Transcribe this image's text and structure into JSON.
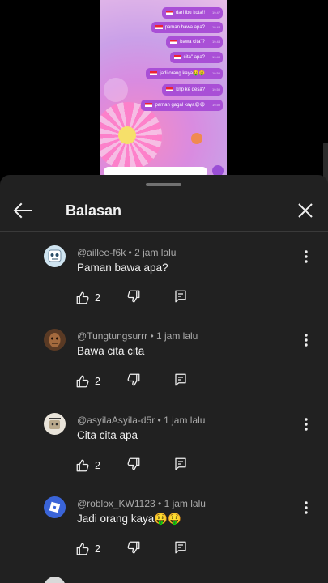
{
  "video": {
    "messages": [
      {
        "text": "dari ibu kota!!",
        "time": "19.47"
      },
      {
        "text": "paman bawa apa?",
        "time": "19.48"
      },
      {
        "text": "bawa cita\"?",
        "time": "19.48"
      },
      {
        "text": "cita\" apa?",
        "time": "19.49"
      },
      {
        "text": "jadi orang kaya🤑🤑",
        "time": "19.50"
      },
      {
        "text": "knp ke desa?",
        "time": "19.50"
      },
      {
        "text": "paman gagal kaya😩😩",
        "time": "19.50"
      }
    ]
  },
  "sheet": {
    "title": "Balasan",
    "back_icon": "arrow-left-icon",
    "close_icon": "close-icon"
  },
  "comments": [
    {
      "author": "@aillee-f6k",
      "time": "2 jam lalu",
      "text": "Paman bawa apa?",
      "likes": "2"
    },
    {
      "author": "@Tungtungsurrr",
      "time": "1 jam lalu",
      "text": "Bawa cita cita",
      "likes": "2"
    },
    {
      "author": "@asyilaAsyila-d5r",
      "time": "1 jam lalu",
      "text": "Cita cita apa",
      "likes": "2"
    },
    {
      "author": "@roblox_KW1123",
      "time": "1 jam lalu",
      "text": "Jadi orang kaya🤑🤑",
      "likes": "2"
    }
  ],
  "colors": {
    "sheet_bg": "#212121",
    "text_primary": "#f1f1f1",
    "text_secondary": "#aaaaaa",
    "bubble": "#a94fd6"
  }
}
